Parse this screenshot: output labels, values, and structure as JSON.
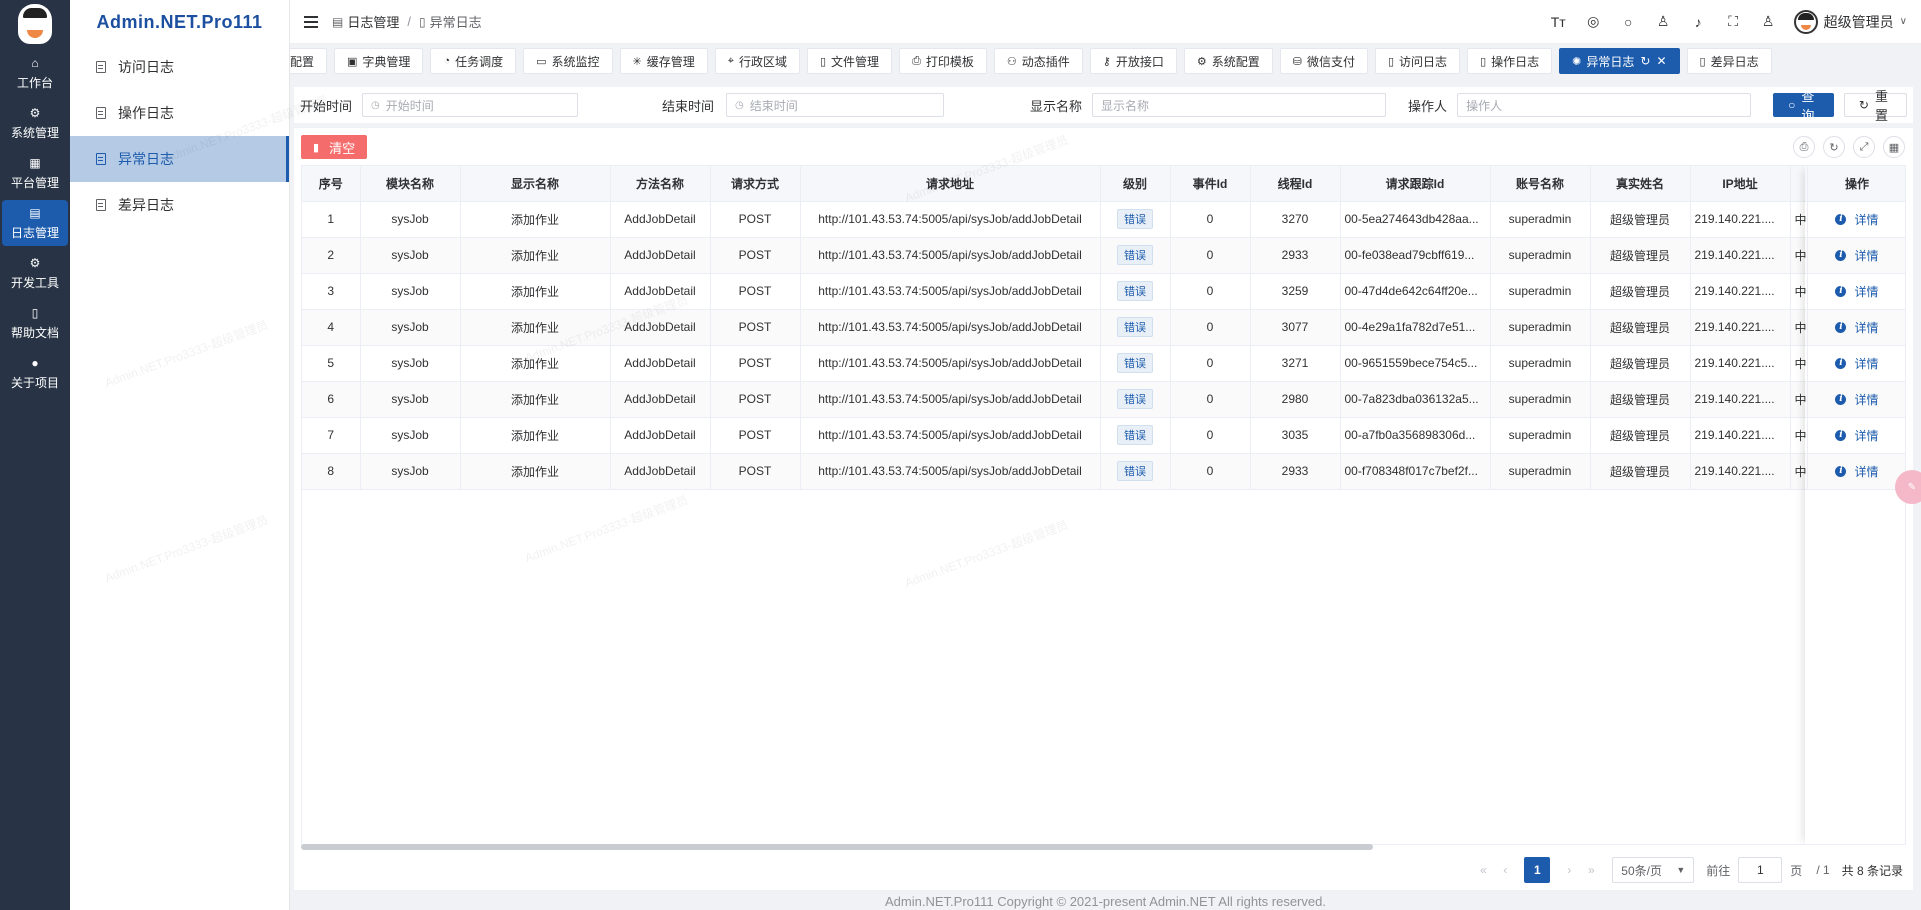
{
  "brand": "Admin.NET.Pro111",
  "rail": [
    {
      "label": "工作台",
      "icon": "home-icon"
    },
    {
      "label": "系统管理",
      "icon": "settings-icon"
    },
    {
      "label": "平台管理",
      "icon": "grid-icon"
    },
    {
      "label": "日志管理",
      "icon": "log-icon"
    },
    {
      "label": "开发工具",
      "icon": "tool-icon"
    },
    {
      "label": "帮助文档",
      "icon": "book-icon"
    },
    {
      "label": "关于项目",
      "icon": "info-icon"
    }
  ],
  "side_menu": [
    {
      "label": "访问日志"
    },
    {
      "label": "操作日志"
    },
    {
      "label": "异常日志"
    },
    {
      "label": "差异日志"
    }
  ],
  "breadcrumb": {
    "parent": "日志管理",
    "separator": "/",
    "current": "异常日志"
  },
  "header": {
    "user_name": "超级管理员"
  },
  "tags": [
    "配置",
    "字典管理",
    "任务调度",
    "系统监控",
    "缓存管理",
    "行政区域",
    "文件管理",
    "打印模板",
    "动态插件",
    "开放接口",
    "系统配置",
    "微信支付",
    "访问日志",
    "操作日志",
    "异常日志",
    "差异日志"
  ],
  "search": {
    "start_label": "开始时间",
    "start_placeholder": "开始时间",
    "end_label": "结束时间",
    "end_placeholder": "结束时间",
    "display_label": "显示名称",
    "display_placeholder": "显示名称",
    "operator_label": "操作人",
    "operator_placeholder": "操作人",
    "query": "查询",
    "reset": "重置"
  },
  "toolbar": {
    "clear": "清空"
  },
  "table": {
    "columns": [
      "序号",
      "模块名称",
      "显示名称",
      "方法名称",
      "请求方式",
      "请求地址",
      "级别",
      "事件Id",
      "线程Id",
      "请求跟踪Id",
      "账号名称",
      "真实姓名",
      "IP地址",
      "",
      "操作"
    ],
    "rows": [
      [
        "1",
        "sysJob",
        "添加作业",
        "AddJobDetail",
        "POST",
        "http://101.43.53.74:5005/api/sysJob/addJobDetail",
        "错误",
        "0",
        "3270",
        "00-5ea274643db428aa...",
        "superadmin",
        "超级管理员",
        "219.140.221....",
        "中",
        "详情"
      ],
      [
        "2",
        "sysJob",
        "添加作业",
        "AddJobDetail",
        "POST",
        "http://101.43.53.74:5005/api/sysJob/addJobDetail",
        "错误",
        "0",
        "2933",
        "00-fe038ead79cbff619...",
        "superadmin",
        "超级管理员",
        "219.140.221....",
        "中",
        "详情"
      ],
      [
        "3",
        "sysJob",
        "添加作业",
        "AddJobDetail",
        "POST",
        "http://101.43.53.74:5005/api/sysJob/addJobDetail",
        "错误",
        "0",
        "3259",
        "00-47d4de642c64ff20e...",
        "superadmin",
        "超级管理员",
        "219.140.221....",
        "中",
        "详情"
      ],
      [
        "4",
        "sysJob",
        "添加作业",
        "AddJobDetail",
        "POST",
        "http://101.43.53.74:5005/api/sysJob/addJobDetail",
        "错误",
        "0",
        "3077",
        "00-4e29a1fa782d7e51...",
        "superadmin",
        "超级管理员",
        "219.140.221....",
        "中",
        "详情"
      ],
      [
        "5",
        "sysJob",
        "添加作业",
        "AddJobDetail",
        "POST",
        "http://101.43.53.74:5005/api/sysJob/addJobDetail",
        "错误",
        "0",
        "3271",
        "00-9651559bece754c5...",
        "superadmin",
        "超级管理员",
        "219.140.221....",
        "中",
        "详情"
      ],
      [
        "6",
        "sysJob",
        "添加作业",
        "AddJobDetail",
        "POST",
        "http://101.43.53.74:5005/api/sysJob/addJobDetail",
        "错误",
        "0",
        "2980",
        "00-7a823dba036132a5...",
        "superadmin",
        "超级管理员",
        "219.140.221....",
        "中",
        "详情"
      ],
      [
        "7",
        "sysJob",
        "添加作业",
        "AddJobDetail",
        "POST",
        "http://101.43.53.74:5005/api/sysJob/addJobDetail",
        "错误",
        "0",
        "3035",
        "00-a7fb0a356898306d...",
        "superadmin",
        "超级管理员",
        "219.140.221....",
        "中",
        "详情"
      ],
      [
        "8",
        "sysJob",
        "添加作业",
        "AddJobDetail",
        "POST",
        "http://101.43.53.74:5005/api/sysJob/addJobDetail",
        "错误",
        "0",
        "2933",
        "00-f708348f017c7bef2f...",
        "superadmin",
        "超级管理员",
        "219.140.221....",
        "中",
        "详情"
      ]
    ]
  },
  "pager": {
    "page": "1",
    "page_size": "50条/页",
    "goto_label": "前往",
    "goto_value": "1",
    "page_unit": "页",
    "total_pages": "/ 1",
    "total": "共 8 条记录"
  },
  "footer": "Admin.NET.Pro111 Copyright © 2021-present Admin.NET All rights reserved.",
  "watermark": "Admin.NET.Pro3333-超级管理员",
  "colors": {
    "primary": "#1d5cad",
    "danger": "#f56c6c",
    "rail": "#283445"
  }
}
